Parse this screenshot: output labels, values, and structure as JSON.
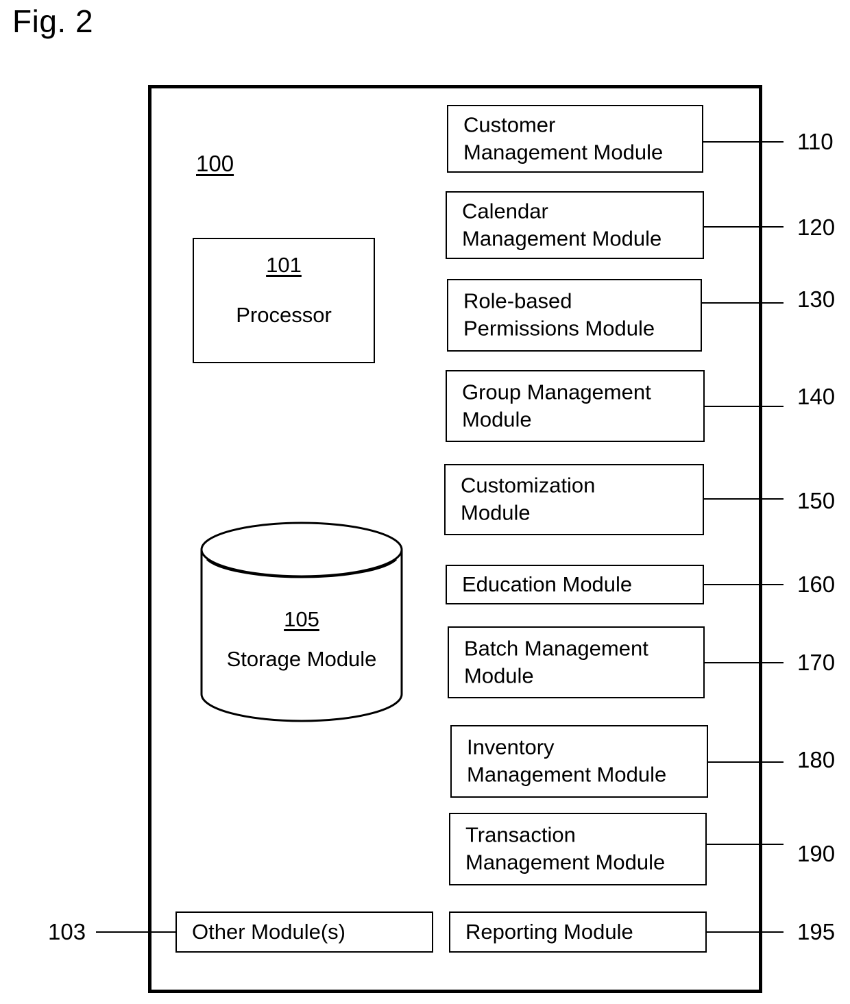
{
  "figure": {
    "caption": "Fig. 2"
  },
  "system": {
    "ref": "100",
    "processor": {
      "ref": "101",
      "label": "Processor"
    },
    "storage": {
      "ref": "105",
      "label": "Storage\nModule"
    }
  },
  "modules": [
    {
      "label": "Customer\nManagement Module",
      "ref": "110"
    },
    {
      "label": "Calendar\nManagement Module",
      "ref": "120"
    },
    {
      "label": "Role-based\nPermissions Module",
      "ref": "130"
    },
    {
      "label": "Group Management\nModule",
      "ref": "140"
    },
    {
      "label": "Customization\nModule",
      "ref": "150"
    },
    {
      "label": "Education Module",
      "ref": "160"
    },
    {
      "label": "Batch Management\nModule",
      "ref": "170"
    },
    {
      "label": "Inventory\nManagement Module",
      "ref": "180"
    },
    {
      "label": "Transaction\nManagement Module",
      "ref": "190"
    }
  ],
  "bottom": {
    "other": {
      "label": "Other Module(s)",
      "ref": "103"
    },
    "reporting": {
      "label": "Reporting Module",
      "ref": "195"
    }
  }
}
